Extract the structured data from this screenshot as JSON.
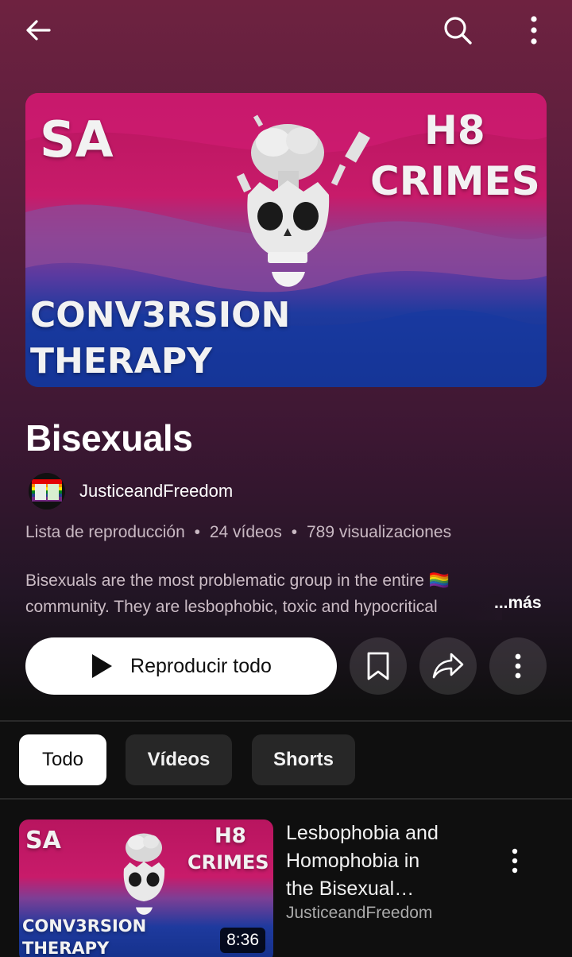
{
  "topbar": {
    "back_icon": "arrow-left-icon",
    "search_icon": "search-icon",
    "more_icon": "more-vert-icon"
  },
  "hero": {
    "text_sa": "SA",
    "text_h8": "H8",
    "text_crimes": "CRIMES",
    "text_conv": "CONV3RSION",
    "text_therapy": "THERAPY"
  },
  "playlist": {
    "title": "Bisexuals",
    "channel": "JusticeandFreedom",
    "meta": {
      "type": "Lista de reproducción",
      "videos": "24 vídeos",
      "views": "789 visualizaciones",
      "separator": "•"
    },
    "description_line1": "Bisexuals are the most problematic group in the entire 🏳️‍🌈",
    "description_line2": "community. They are lesbophobic, toxic and hypocritical",
    "more_label": "...más"
  },
  "actions": {
    "play_all_label": "Reproducir todo",
    "save_icon": "bookmark-icon",
    "share_icon": "share-icon",
    "more_icon": "more-vert-icon"
  },
  "chips": [
    {
      "label": "Todo",
      "active": true
    },
    {
      "label": "Vídeos",
      "active": false
    },
    {
      "label": "Shorts",
      "active": false
    }
  ],
  "videos": [
    {
      "title_line1": "Lesbophobia and",
      "title_line2": "Homophobia in",
      "title_line3": "the Bisexual…",
      "channel": "JusticeandFreedom",
      "duration": "8:36",
      "thumb_text_sa": "SA",
      "thumb_text_h8": "H8",
      "thumb_text_crimes": "CRIMES",
      "thumb_text_conv": "CONV3RSION",
      "thumb_text_therapy": "THERAPY"
    }
  ],
  "colors": {
    "flag_pink": "#d60270",
    "flag_purple": "#9b4f96",
    "flag_blue": "#0038a8"
  }
}
